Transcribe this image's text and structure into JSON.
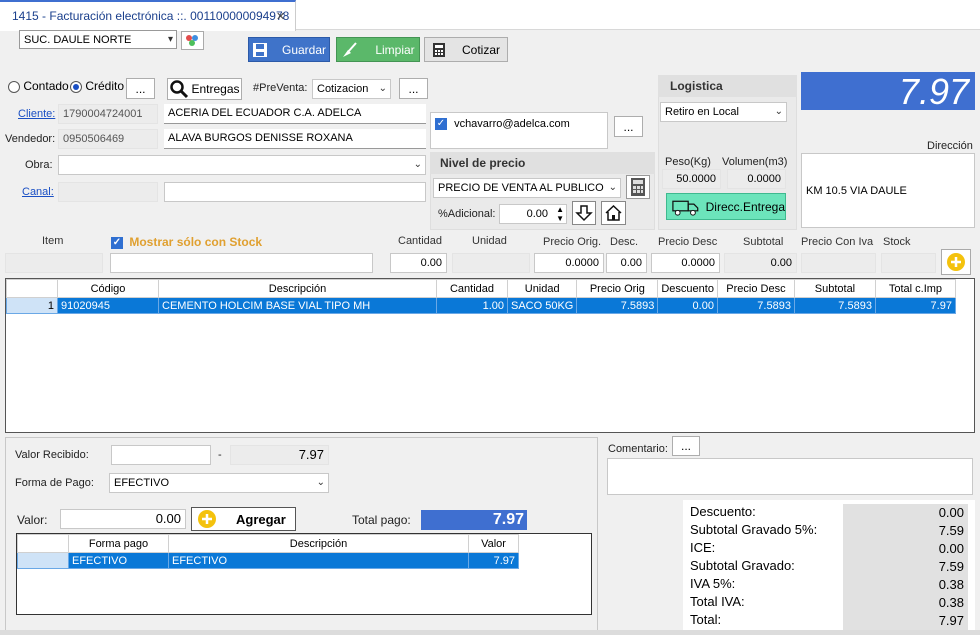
{
  "tab": {
    "title": "1415 - Facturación electrónica ::. 001100000094978",
    "close": "✕"
  },
  "branch": {
    "value": "SUC. DAULE NORTE"
  },
  "toolbar": {
    "save": "Guardar",
    "clear": "Limpiar",
    "quote": "Cotizar"
  },
  "payment_type": {
    "cash": "Contado",
    "credit": "Crédito",
    "more": "...",
    "deliveries": "Entregas",
    "preventa_label": "#PreVenta:",
    "preventa_value": "Cotizacion",
    "preventa_more": "..."
  },
  "client": {
    "label": "Cliente:",
    "id": "1790004724001",
    "name": "ACERIA DEL ECUADOR C.A. ADELCA"
  },
  "seller": {
    "label": "Vendedor:",
    "id": "0950506469",
    "name": "ALAVA BURGOS DENISSE ROXANA"
  },
  "work": {
    "label": "Obra:",
    "value": ""
  },
  "channel": {
    "label": "Canal:",
    "value": ""
  },
  "email": {
    "value": "vchavarro@adelca.com",
    "more": "..."
  },
  "price_level": {
    "title": "Nivel de precio",
    "value": "PRECIO DE VENTA AL PUBLICO",
    "additional_label": "%Adicional:",
    "additional_value": "0.00"
  },
  "logistics": {
    "title": "Logistica",
    "mode": "Retiro en Local",
    "weight_label": "Peso(Kg)",
    "weight": "50.0000",
    "volume_label": "Volumen(m3)",
    "volume": "0.0000",
    "delivery_button": "Direcc.Entrega"
  },
  "total_display": "7.97",
  "address": {
    "label": "Dirección",
    "value": "KM 10.5 VIA DAULE"
  },
  "entry": {
    "item_label": "Item",
    "show_stock": "Mostrar sólo con Stock",
    "qty_label": "Cantidad",
    "qty": "0.00",
    "unit_label": "Unidad",
    "orig_price_label": "Precio Orig.",
    "orig_price": "0.0000",
    "disc_label": "Desc.",
    "disc": "0.00",
    "price_disc_label": "Precio Desc",
    "price_disc": "0.0000",
    "subtotal_label": "Subtotal",
    "subtotal": "0.00",
    "price_iva_label": "Precio Con Iva",
    "stock_label": "Stock"
  },
  "items_table": {
    "columns": [
      "Código",
      "Descripción",
      "Cantidad",
      "Unidad",
      "Precio Orig",
      "Descuento",
      "Precio Desc",
      "Subtotal",
      "Total c.Imp"
    ],
    "rows": [
      {
        "n": "1",
        "code": "91020945",
        "desc": "CEMENTO HOLCIM BASE VIAL TIPO MH",
        "qty": "1.00",
        "unit": "SACO 50KG",
        "orig": "7.5893",
        "disc": "0.00",
        "pdesc": "7.5893",
        "sub": "7.5893",
        "total": "7.97"
      }
    ]
  },
  "payment": {
    "received_label": "Valor Recibido:",
    "received": "",
    "dash": "-",
    "change": "7.97",
    "method_label": "Forma de Pago:",
    "method": "EFECTIVO",
    "value_label": "Valor:",
    "value": "0.00",
    "add": "Agregar",
    "total_label": "Total pago:",
    "total": "7.97",
    "columns": [
      "Forma pago",
      "Descripción",
      "Valor"
    ],
    "rows": [
      {
        "method": "EFECTIVO",
        "desc": "EFECTIVO",
        "value": "7.97"
      }
    ]
  },
  "comment": {
    "label": "Comentario:",
    "more": "..."
  },
  "totals": [
    {
      "label": "Descuento:",
      "value": "0.00"
    },
    {
      "label": "Subtotal Gravado 5%:",
      "value": "7.59"
    },
    {
      "label": "ICE:",
      "value": "0.00"
    },
    {
      "label": "Subtotal Gravado:",
      "value": "7.59"
    },
    {
      "label": "IVA 5%:",
      "value": "0.38"
    },
    {
      "label": "Total IVA:",
      "value": "0.38"
    },
    {
      "label": "Total:",
      "value": "7.97"
    }
  ],
  "colors": {
    "accent": "#2f6fd1",
    "total_bg": "#3f6fd0",
    "green": "#4caf50",
    "selection": "#0a78d7"
  }
}
